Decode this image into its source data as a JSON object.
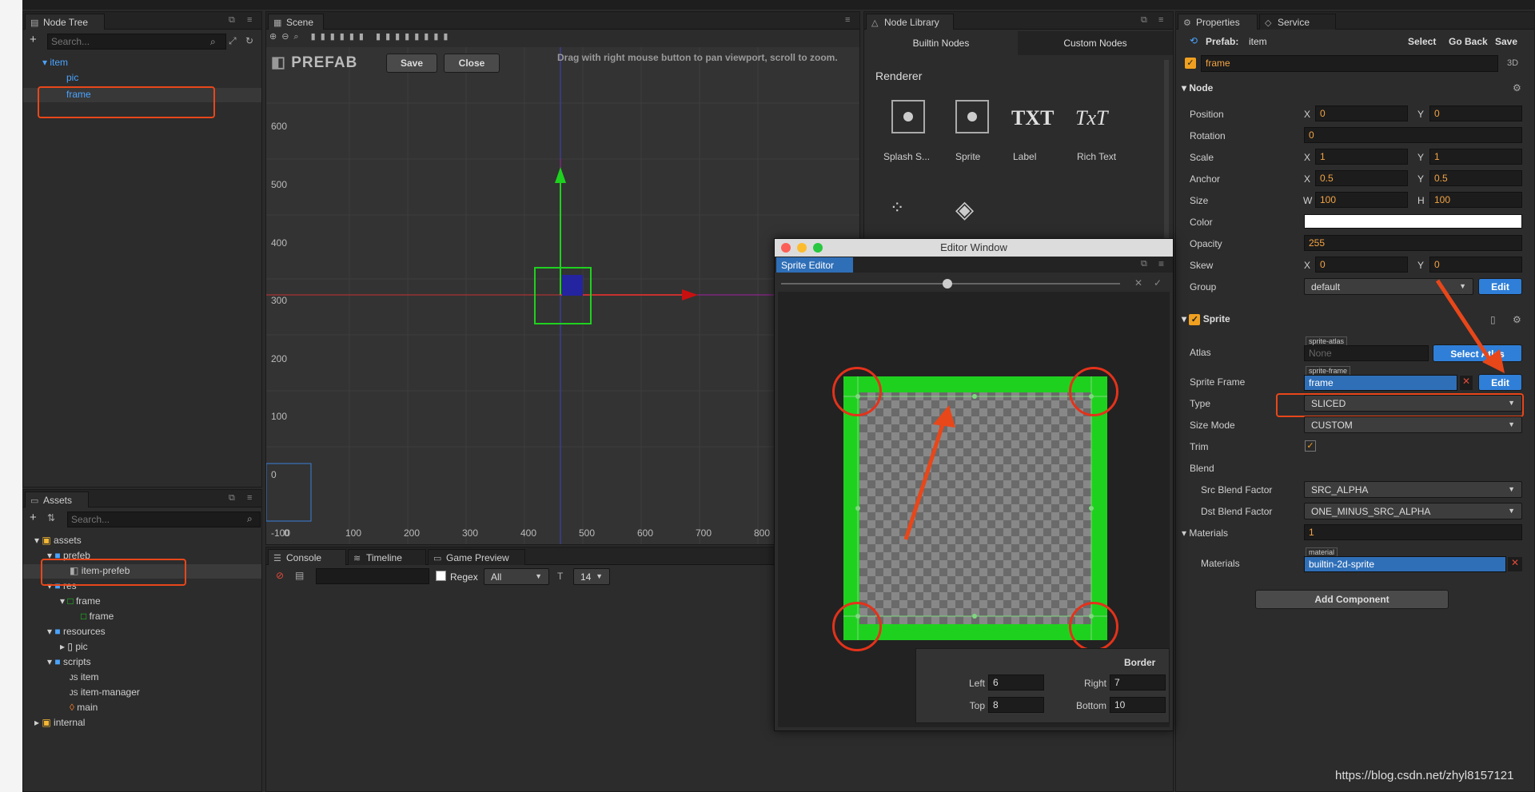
{
  "node_tree": {
    "title": "Node Tree",
    "search_placeholder": "Search...",
    "items": [
      "item",
      "pic",
      "frame"
    ]
  },
  "scene": {
    "title": "Scene",
    "prefab_label": "PREFAB",
    "save": "Save",
    "close": "Close",
    "hint": "Drag with right mouse button to pan viewport, scroll to zoom.",
    "y_ticks": [
      "600",
      "500",
      "400",
      "300",
      "200",
      "100",
      "0"
    ],
    "x_ticks": [
      "-100",
      "0",
      "100",
      "200",
      "300",
      "400",
      "500",
      "600",
      "700",
      "800"
    ]
  },
  "node_library": {
    "title": "Node Library",
    "tabs": [
      "Builtin Nodes",
      "Custom Nodes"
    ],
    "section": "Renderer",
    "items": [
      "Splash S...",
      "Sprite",
      "Label",
      "Rich Text"
    ],
    "label_glyph": "TXT",
    "rich_glyph": "TxT"
  },
  "editor_window": {
    "title": "Editor Window",
    "tab": "Sprite Editor",
    "border": {
      "title": "Border",
      "left_label": "Left",
      "left": "6",
      "right_label": "Right",
      "right": "7",
      "top_label": "Top",
      "top": "8",
      "bottom_label": "Bottom",
      "bottom": "10"
    }
  },
  "assets": {
    "title": "Assets",
    "search_placeholder": "Search...",
    "items": [
      "assets",
      "prefeb",
      "item-prefeb",
      "res",
      "frame",
      "frame",
      "resources",
      "pic",
      "scripts",
      "item",
      "item-manager",
      "main",
      "internal"
    ]
  },
  "console": {
    "tabs": [
      "Console",
      "Timeline",
      "Game Preview"
    ],
    "regex": "Regex",
    "filter": "All",
    "font_size": "14"
  },
  "properties": {
    "tabs": [
      "Properties",
      "Service"
    ],
    "prefab_label": "Prefab:",
    "prefab_name": "item",
    "select": "Select",
    "go_back": "Go Back",
    "save": "Save",
    "node_name": "frame",
    "mode": "3D",
    "node_section": "Node",
    "position_label": "Position",
    "pos_x": "0",
    "pos_y": "0",
    "rotation_label": "Rotation",
    "rotation": "0",
    "scale_label": "Scale",
    "scale_x": "1",
    "scale_y": "1",
    "anchor_label": "Anchor",
    "anchor_x": "0.5",
    "anchor_y": "0.5",
    "size_label": "Size",
    "size_w": "100",
    "size_h": "100",
    "color_label": "Color",
    "opacity_label": "Opacity",
    "opacity": "255",
    "skew_label": "Skew",
    "skew_x": "0",
    "skew_y": "0",
    "group_label": "Group",
    "group": "default",
    "edit": "Edit",
    "x": "X",
    "y": "Y",
    "w": "W",
    "h": "H",
    "sprite_section": "Sprite",
    "atlas_label": "Atlas",
    "atlas_tag": "sprite-atlas",
    "atlas_value": "None",
    "select_atlas": "Select Atlas",
    "sprite_frame_label": "Sprite Frame",
    "sprite_frame_tag": "sprite-frame",
    "sprite_frame": "frame",
    "type_label": "Type",
    "type": "SLICED",
    "size_mode_label": "Size Mode",
    "size_mode": "CUSTOM",
    "trim_label": "Trim",
    "blend_label": "Blend",
    "src_label": "Src Blend Factor",
    "src": "SRC_ALPHA",
    "dst_label": "Dst Blend Factor",
    "dst": "ONE_MINUS_SRC_ALPHA",
    "materials_label": "Materials",
    "materials_count": "1",
    "materials_item_label": "Materials",
    "material_tag": "material",
    "material": "builtin-2d-sprite",
    "add_component": "Add Component"
  },
  "watermark": "https://blog.csdn.net/zhyl8157121",
  "colors": {
    "accent": "#2f7fd8",
    "annotation": "#e4321a",
    "sprite_green": "#1fd11f"
  }
}
